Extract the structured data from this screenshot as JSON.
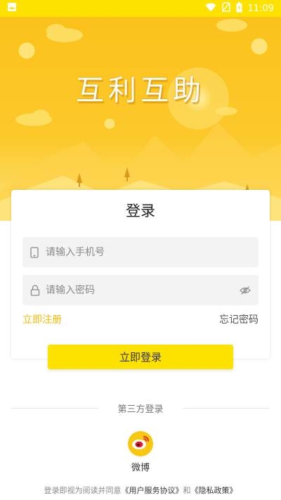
{
  "status_bar": {
    "time": "11:09",
    "icons": [
      "image-icon",
      "wifi-icon",
      "no-sim-icon",
      "battery-icon"
    ],
    "background": "#fde200"
  },
  "hero": {
    "title": "互利互助",
    "background_top": "#fbc21b",
    "background_bottom": "#fde37a"
  },
  "login_card": {
    "title": "登录",
    "phone_placeholder": "请输入手机号",
    "phone_icon": "phone-icon",
    "password_placeholder": "请输入密码",
    "password_icon": "lock-icon",
    "toggle_icon": "eye-icon",
    "register_label": "立即注册",
    "forgot_label": "忘记密码"
  },
  "login_button": {
    "label": "立即登录",
    "color": "#fde200"
  },
  "third_party": {
    "label": "第三方登录",
    "weibo_label": "微博",
    "weibo_icon": "weibo-icon"
  },
  "agreement": {
    "prefix": "登录即视为阅读并同意",
    "user_agreement": "《用户服务协议》",
    "conjunction": "和",
    "privacy_policy": "《隐私政策》"
  },
  "colors": {
    "accent": "#fde200",
    "link": "#f5b800"
  }
}
